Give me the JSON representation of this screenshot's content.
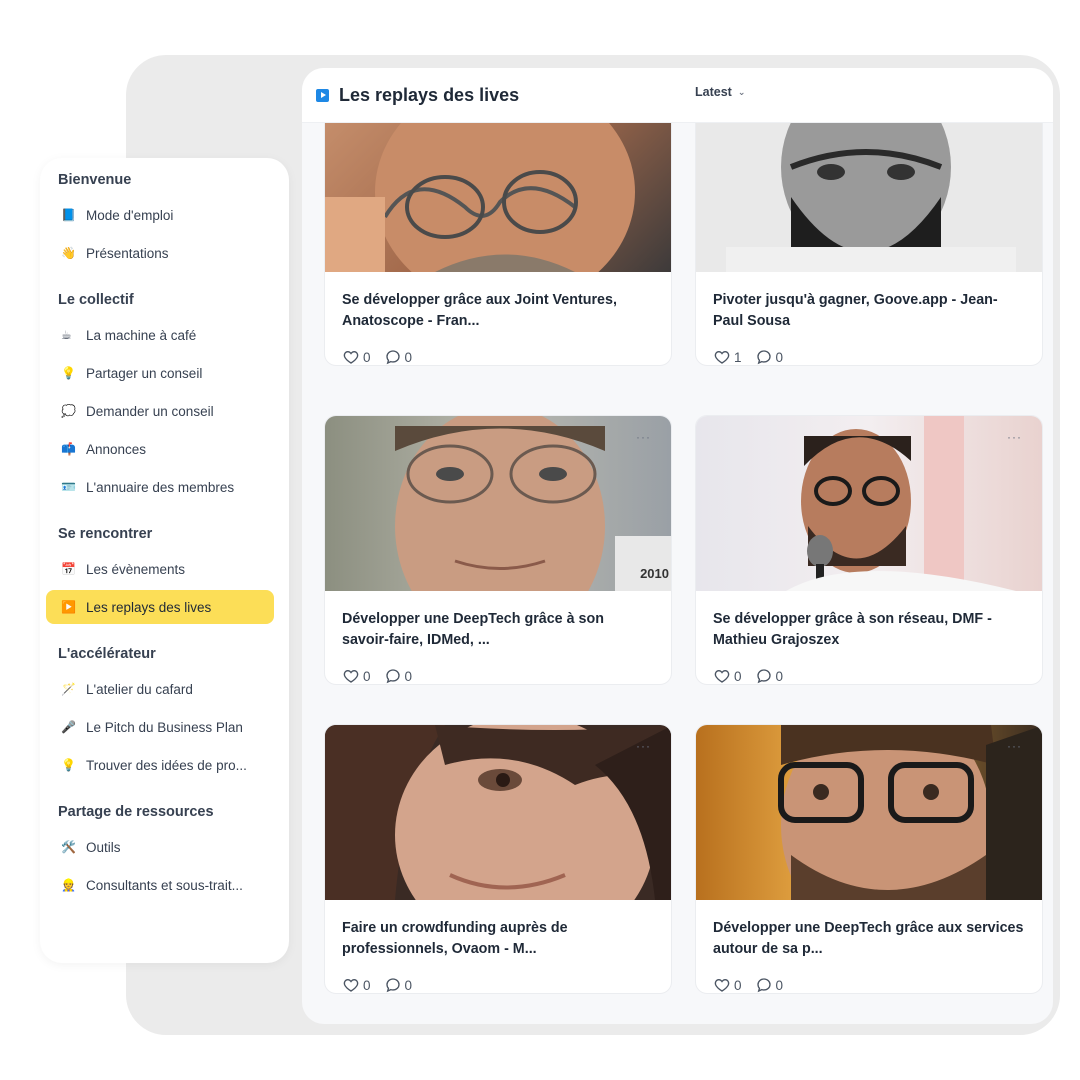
{
  "sidebar": {
    "sections": [
      {
        "heading": "Bienvenue",
        "items": [
          {
            "icon": "📘",
            "label": "Mode d'emploi"
          },
          {
            "icon": "👋",
            "label": "Présentations"
          }
        ]
      },
      {
        "heading": "Le collectif",
        "items": [
          {
            "icon": "☕",
            "label": "La machine à café"
          },
          {
            "icon": "💡",
            "label": "Partager un conseil"
          },
          {
            "icon": "💭",
            "label": "Demander un conseil"
          },
          {
            "icon": "📫",
            "label": "Annonces"
          },
          {
            "icon": "🪪",
            "label": "L'annuaire des membres"
          }
        ]
      },
      {
        "heading": "Se rencontrer",
        "items": [
          {
            "icon": "📅",
            "label": "Les évènements"
          },
          {
            "icon": "▶️",
            "label": "Les replays des lives",
            "active": true
          }
        ]
      },
      {
        "heading": "L'accélérateur",
        "items": [
          {
            "icon": "🪄",
            "label": "L'atelier du cafard"
          },
          {
            "icon": "🎤",
            "label": "Le Pitch du Business Plan"
          },
          {
            "icon": "💡",
            "label": "Trouver des idées de pro..."
          }
        ]
      },
      {
        "heading": "Partage de ressources",
        "items": [
          {
            "icon": "🛠️",
            "label": "Outils"
          },
          {
            "icon": "👷",
            "label": "Consultants et sous-trait..."
          }
        ]
      }
    ]
  },
  "header": {
    "title": "Les replays des lives",
    "sort_label": "Latest"
  },
  "cards": [
    {
      "title": "Se développer grâce aux Joint Ventures, Anatoscope - Fran...",
      "likes": "0",
      "comments": "0"
    },
    {
      "title": "Pivoter jusqu'à gagner, Goove.app - Jean-Paul Sousa",
      "likes": "1",
      "comments": "0"
    },
    {
      "title": "Développer une DeepTech grâce à son savoir-faire, IDMed, ...",
      "likes": "0",
      "comments": "0",
      "image_caption": "2010"
    },
    {
      "title": "Se développer grâce à son réseau, DMF - Mathieu Grajoszex",
      "likes": "0",
      "comments": "0"
    },
    {
      "title": "Faire un crowdfunding auprès de professionnels, Ovaom - M...",
      "likes": "0",
      "comments": "0"
    },
    {
      "title": "Développer une DeepTech grâce aux services autour de sa p...",
      "likes": "0",
      "comments": "0"
    }
  ],
  "colors": {
    "accent": "#fcde57",
    "play_blue": "#1e88e5"
  }
}
